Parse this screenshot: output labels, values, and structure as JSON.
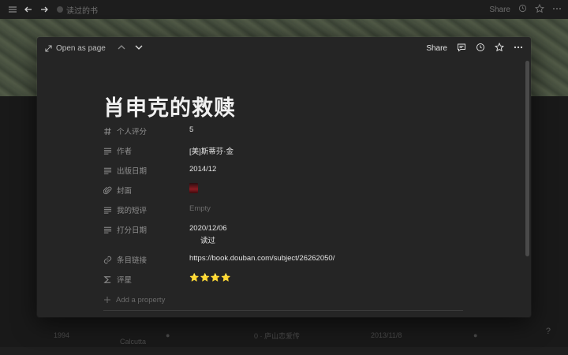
{
  "topbar": {
    "breadcrumb": "读过的书",
    "share_label": "Share"
  },
  "modal": {
    "open_as_page": "Open as page",
    "share_label": "Share",
    "title": "肖申克的救赎",
    "properties": [
      {
        "name": "个人评分",
        "value": "5",
        "icon": "hash-icon"
      },
      {
        "name": "作者",
        "value": "[美]斯蒂芬·金",
        "icon": "text-icon"
      },
      {
        "name": "出版日期",
        "value": "2014/12",
        "icon": "text-icon"
      },
      {
        "name": "封面",
        "value": "",
        "icon": "paperclip-icon"
      },
      {
        "name": "我的短评",
        "value": "Empty",
        "icon": "text-icon"
      },
      {
        "name": "打分日期",
        "value": "2020/12/06",
        "sub": "读过",
        "icon": "text-icon"
      },
      {
        "name": "条目链接",
        "value": "https://book.douban.com/subject/26262050/",
        "icon": "link-icon"
      },
      {
        "name": "评星",
        "value": "⭐⭐⭐⭐",
        "icon": "sigma-icon"
      }
    ],
    "add_property": "Add a property"
  },
  "background_row": {
    "col1": "1994",
    "col2": "Calcutta",
    "col3": "0 · 庐山恋爱传",
    "col4": "2013/11/8"
  },
  "help": "?"
}
